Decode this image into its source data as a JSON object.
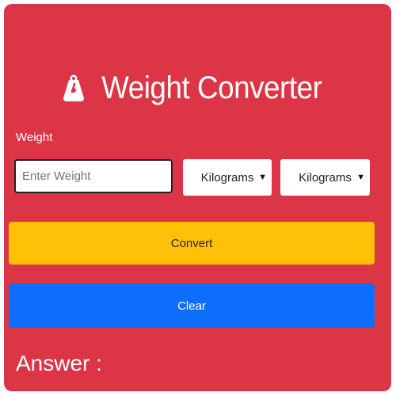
{
  "header": {
    "title": "Weight Converter",
    "icon": "weight-icon"
  },
  "form": {
    "weight_label": "Weight",
    "weight_placeholder": "Enter Weight",
    "weight_value": "",
    "from_unit": "Kilograms",
    "to_unit": "Kilograms"
  },
  "buttons": {
    "convert_label": "Convert",
    "clear_label": "Clear"
  },
  "result": {
    "label": "Answer :"
  },
  "colors": {
    "card_background": "#dc3545",
    "convert_button": "#ffc107",
    "clear_button": "#0d6efd",
    "text_light": "#ffffff"
  }
}
